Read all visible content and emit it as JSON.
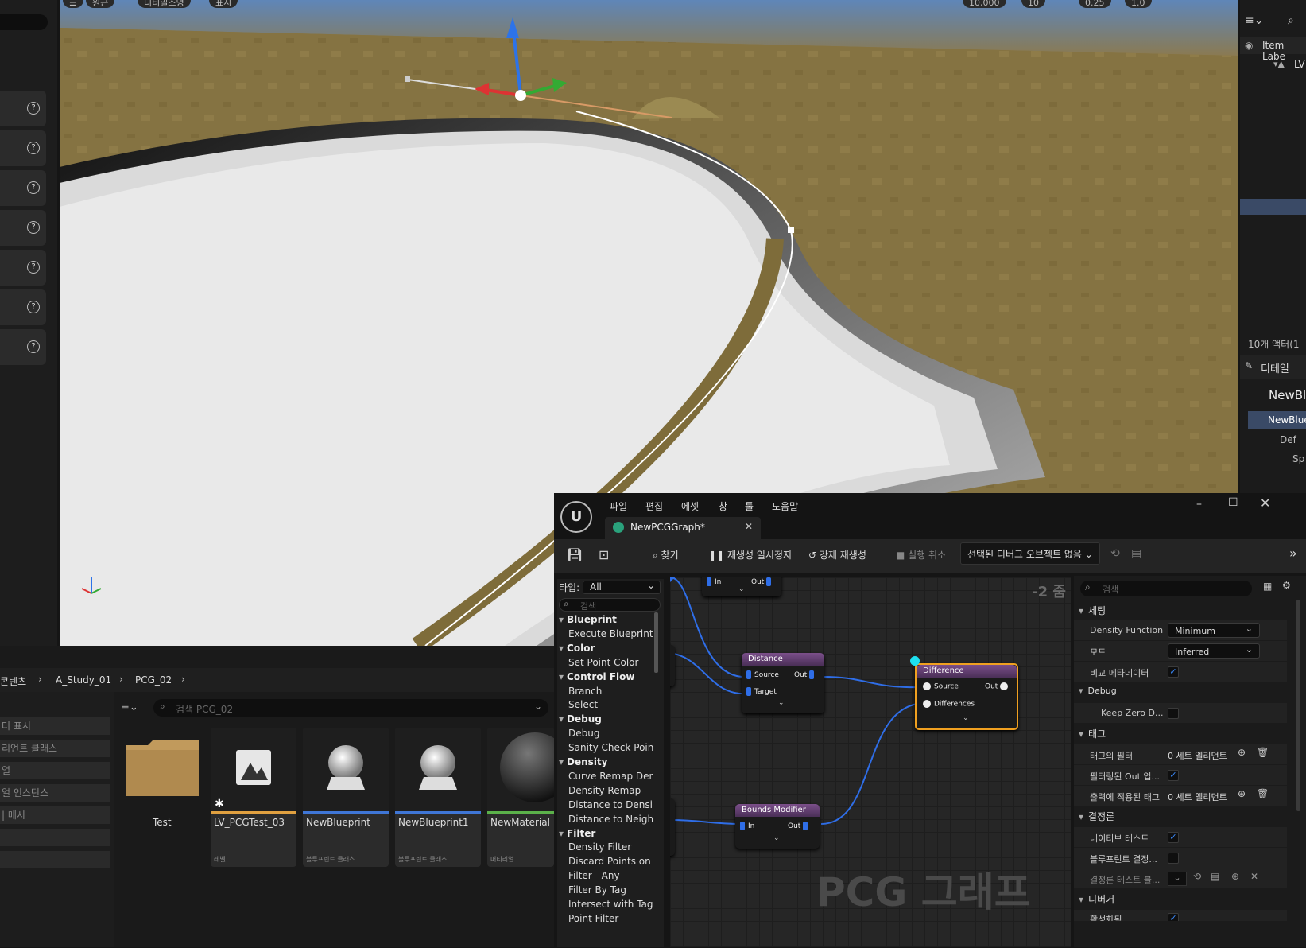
{
  "viewport": {
    "top_buttons": [
      "원근",
      "디티일조명",
      "표시"
    ],
    "right_toolbar": {
      "grid": "10,000",
      "angle": "10",
      "scale": "0.25",
      "camera": "1.0"
    }
  },
  "outliner": {
    "column_header": "Item Labe",
    "root": "LV",
    "actor_count": "10개 액터(1",
    "details_tab": "디테일",
    "selected_name": "NewBl",
    "component": "NewBlue",
    "default": "Def",
    "sub": "Sp"
  },
  "content_browser": {
    "breadcrumb": [
      "콘텐츠",
      "A_Study_01",
      "PCG_02"
    ],
    "search_placeholder": "검색 PCG_02",
    "filters": [
      "터 표시",
      "리언트 클래스",
      "얼",
      "얼 인스턴스",
      "| 메시",
      "",
      ""
    ],
    "assets": [
      {
        "name": "Test",
        "type": "",
        "stripe": "#1a1a1a"
      },
      {
        "name": "LV_PCGTest_03",
        "type": "레벨",
        "stripe": "#e0a040"
      },
      {
        "name": "NewBlueprint",
        "type": "블루프린트 클래스",
        "stripe": "#3f76d6"
      },
      {
        "name": "NewBlueprint1",
        "type": "블루프린트 클래스",
        "stripe": "#3f76d6"
      },
      {
        "name": "NewMaterial",
        "type": "머티리얼",
        "stripe": "#5bb14a"
      }
    ]
  },
  "pcg": {
    "menu": [
      "파일",
      "편집",
      "에셋",
      "창",
      "툴",
      "도움말"
    ],
    "tab_title": "NewPCGGraph*",
    "toolbar": {
      "find": "찾기",
      "pause": "재생성 일시정지",
      "force": "강제 재생성",
      "cancel": "실행 취소",
      "debug_object": "선택된 디버그 오브젝트 없음"
    },
    "palette": {
      "type_label": "타입:",
      "type_value": "All",
      "search_placeholder": "검색",
      "entries": [
        {
          "cat": true,
          "label": "Blueprint"
        },
        {
          "cat": false,
          "label": "Execute Blueprint"
        },
        {
          "cat": true,
          "label": "Color"
        },
        {
          "cat": false,
          "label": "Set Point Color"
        },
        {
          "cat": true,
          "label": "Control Flow"
        },
        {
          "cat": false,
          "label": "Branch"
        },
        {
          "cat": false,
          "label": "Select"
        },
        {
          "cat": true,
          "label": "Debug"
        },
        {
          "cat": false,
          "label": "Debug"
        },
        {
          "cat": false,
          "label": "Sanity Check Poin"
        },
        {
          "cat": true,
          "label": "Density"
        },
        {
          "cat": false,
          "label": "Curve Remap Den"
        },
        {
          "cat": false,
          "label": "Density Remap"
        },
        {
          "cat": false,
          "label": "Distance to Densit"
        },
        {
          "cat": false,
          "label": "Distance to Neight"
        },
        {
          "cat": true,
          "label": "Filter"
        },
        {
          "cat": false,
          "label": "Density Filter"
        },
        {
          "cat": false,
          "label": "Discard Points on"
        },
        {
          "cat": false,
          "label": "Filter - Any"
        },
        {
          "cat": false,
          "label": "Filter By Tag"
        },
        {
          "cat": false,
          "label": "Intersect with Tag"
        },
        {
          "cat": false,
          "label": "Point Filter"
        }
      ]
    },
    "graph": {
      "zoom": "-2 줌",
      "watermark": "PCG 그래프",
      "nodes": {
        "top": {
          "in": "In",
          "out": "Out"
        },
        "distance": {
          "title": "Distance",
          "source": "Source",
          "target": "Target",
          "out": "Out"
        },
        "difference": {
          "title": "Difference",
          "source": "Source",
          "differences": "Differences",
          "out": "Out"
        },
        "bounds": {
          "title": "Bounds Modifier",
          "in": "In",
          "out": "Out"
        }
      }
    },
    "details": {
      "search_placeholder": "검색",
      "sections": {
        "settings": "세팅",
        "debug": "Debug",
        "tag": "태그",
        "determinism": "결정론",
        "debugger": "디버거"
      },
      "rows": {
        "density_function": {
          "label": "Density Function",
          "value": "Minimum"
        },
        "mode": {
          "label": "모드",
          "value": "Inferred"
        },
        "compare_meta": {
          "label": "비교 메타데이터",
          "checked": true
        },
        "keep_zero": {
          "label": "Keep Zero D...",
          "checked": false
        },
        "tag_filter": {
          "label": "태그의 필터",
          "value": "0 세트 엘리먼트"
        },
        "filtered_out": {
          "label": "필터링된 Out 입...",
          "checked": true
        },
        "output_tag": {
          "label": "출력에 적용된 태그",
          "value": "0 세트 엘리먼트"
        },
        "native_test": {
          "label": "네이티브 테스트",
          "checked": true
        },
        "bp_determinism": {
          "label": "블루프린트 결정...",
          "checked": false
        },
        "determinism_test": {
          "label": "결정론 테스트 블..."
        },
        "debugger_row": {
          "label": "활성화됨"
        }
      }
    }
  }
}
